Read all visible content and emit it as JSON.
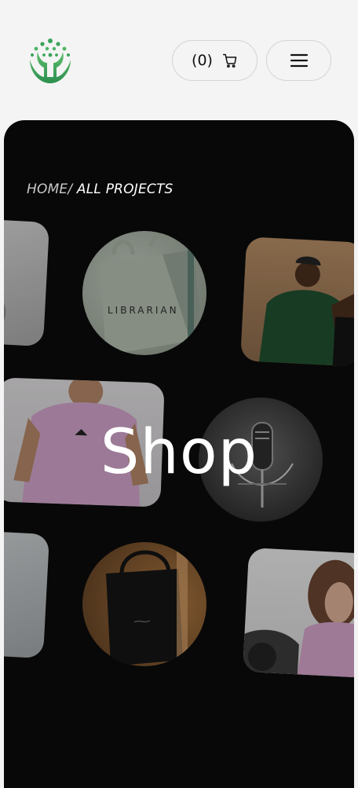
{
  "header": {
    "logo_icon": "coral-tree-logo",
    "cart": {
      "count_label": "(0)",
      "icon": "cart-icon"
    },
    "menu": {
      "icon": "hamburger-menu-icon"
    }
  },
  "hero": {
    "breadcrumb": {
      "home": "HOME/",
      "current": " ALL PROJECTS"
    },
    "title": "Shop",
    "tiles": [
      {
        "name": "tile-grey-left-top",
        "subject": "product photo",
        "text": ""
      },
      {
        "name": "tile-tote-bag-librarian",
        "subject": "tote bag",
        "text": "LIBRARIAN"
      },
      {
        "name": "tile-man-green-tshirt",
        "subject": "model in green t-shirt",
        "text": ""
      },
      {
        "name": "tile-man-pink-tshirt",
        "subject": "model in pink t-shirt",
        "text": ""
      },
      {
        "name": "tile-microphone",
        "subject": "studio microphone",
        "text": ""
      },
      {
        "name": "tile-grey-left-bottom",
        "subject": "product photo",
        "text": ""
      },
      {
        "name": "tile-black-tote-bag",
        "subject": "black tote bag",
        "text": ""
      },
      {
        "name": "tile-woman-pink-hoodie",
        "subject": "model in pink hoodie",
        "text": ""
      }
    ]
  },
  "colors": {
    "page_bg": "#f4f4f4",
    "hero_bg": "#080808",
    "brand_green": "#3aa35a"
  }
}
